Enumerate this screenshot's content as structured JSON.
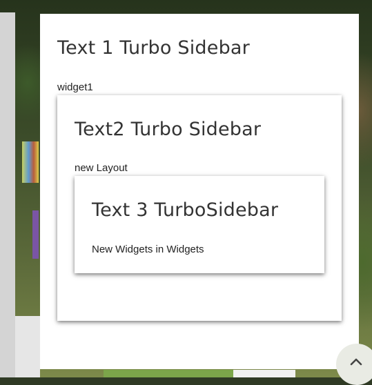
{
  "sections": {
    "outer": {
      "title": "Text 1 Turbo Sidebar",
      "label": "widget1"
    },
    "middle": {
      "title": "Text2 Turbo Sidebar",
      "label": "new Layout"
    },
    "inner": {
      "title": "Text 3 TurboSidebar",
      "label": "New Widgets in Widgets"
    }
  },
  "scroll_top": {
    "icon": "chevron-up-icon"
  },
  "colors": {
    "panel_bg": "#ffffff",
    "title_text": "#333333",
    "body_text": "#222222",
    "left_strip": "#d4d4d4"
  }
}
